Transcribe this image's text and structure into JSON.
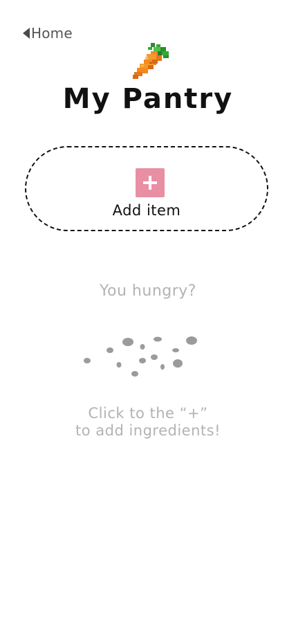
{
  "nav": {
    "back_label": "Home"
  },
  "header": {
    "icon": "carrot-icon",
    "title": "My Pantry"
  },
  "add_item": {
    "label": "Add item",
    "icon": "plus-icon",
    "accent_color": "#e88fa4"
  },
  "empty_state": {
    "heading": "You hungry?",
    "illustration": "crumbs-icon",
    "hint_line1": "Click to the “+”",
    "hint_line2": "to add ingredients!"
  }
}
